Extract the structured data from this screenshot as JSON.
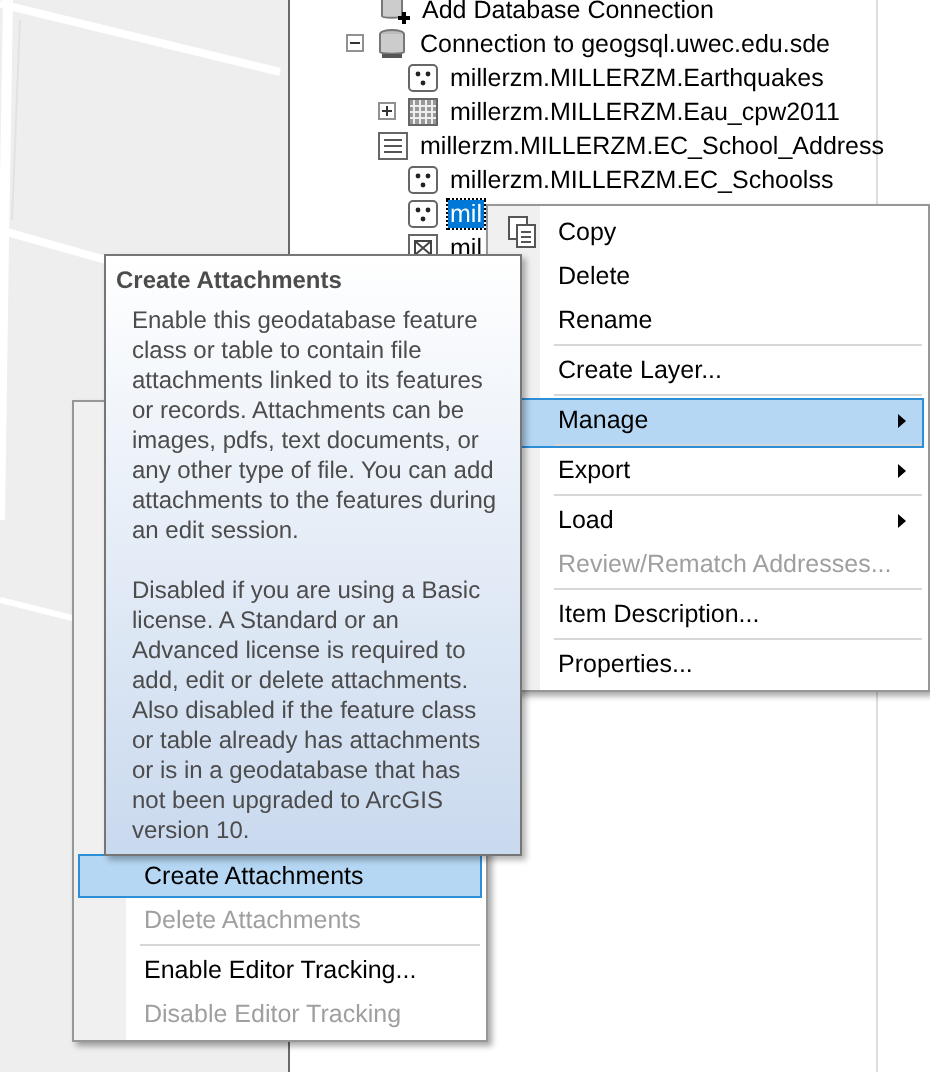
{
  "tree": {
    "items": [
      {
        "label": "Add Database Connection",
        "kind": "add-connection"
      },
      {
        "label": "Connection to geogsql.uwec.edu.sde",
        "kind": "database",
        "expanded": true,
        "children": [
          {
            "label": "millerzm.MILLERZM.Earthquakes",
            "kind": "point",
            "selected": false
          },
          {
            "label": "millerzm.MILLERZM.Eau_cpw2011",
            "kind": "raster",
            "expandable": true,
            "selected": false
          },
          {
            "label": "millerzm.MILLERZM.EC_School_Address",
            "kind": "table",
            "selected": false
          },
          {
            "label": "millerzm.MILLERZM.EC_Schoolss",
            "kind": "point",
            "selected": false
          },
          {
            "label": "mil",
            "kind": "point",
            "selected": true
          },
          {
            "label": "mil",
            "kind": "network",
            "selected": false
          }
        ]
      }
    ]
  },
  "context_menu": {
    "items": [
      {
        "label": "Copy",
        "kind": "copy",
        "selected": false,
        "disabled": false,
        "submenu": false,
        "separator_after": false
      },
      {
        "label": "Delete",
        "selected": false,
        "disabled": false,
        "submenu": false,
        "separator_after": false
      },
      {
        "label": "Rename",
        "selected": false,
        "disabled": false,
        "submenu": false,
        "separator_after": true
      },
      {
        "label": "Create Layer...",
        "selected": false,
        "disabled": false,
        "submenu": false,
        "separator_after": true
      },
      {
        "label": "Manage",
        "selected": true,
        "disabled": false,
        "submenu": true,
        "separator_after": true
      },
      {
        "label": "Export",
        "selected": false,
        "disabled": false,
        "submenu": true,
        "separator_after": true
      },
      {
        "label": "Load",
        "selected": false,
        "disabled": false,
        "submenu": true,
        "separator_after": false
      },
      {
        "label": "Review/Rematch Addresses...",
        "selected": false,
        "disabled": true,
        "submenu": false,
        "separator_after": true
      },
      {
        "label": "Item Description...",
        "selected": false,
        "disabled": false,
        "submenu": false,
        "separator_after": true
      },
      {
        "label": "Properties...",
        "selected": false,
        "disabled": false,
        "submenu": false,
        "separator_after": false
      }
    ]
  },
  "submenu": {
    "items": [
      {
        "label": "Create Attachments",
        "selected": true,
        "disabled": false,
        "separator_after": false
      },
      {
        "label": "Delete Attachments",
        "selected": false,
        "disabled": true,
        "separator_after": true
      },
      {
        "label": "Enable Editor Tracking...",
        "selected": false,
        "disabled": false,
        "separator_after": false
      },
      {
        "label": "Disable Editor Tracking",
        "selected": false,
        "disabled": true,
        "separator_after": false
      }
    ]
  },
  "tooltip": {
    "title": "Create Attachments",
    "paragraphs": [
      "Enable this geodatabase feature class or table to contain file attachments linked to its features or records. Attachments can be images, pdfs, text documents, or any other type of file. You can add attachments to the features during an edit session.",
      "Disabled if you are using a Basic license. A Standard or an Advanced license is required to add, edit or delete attachments. Also disabled if the feature class or table already has attachments or is in a geodatabase that has not been upgraded to ArcGIS version 10."
    ]
  }
}
